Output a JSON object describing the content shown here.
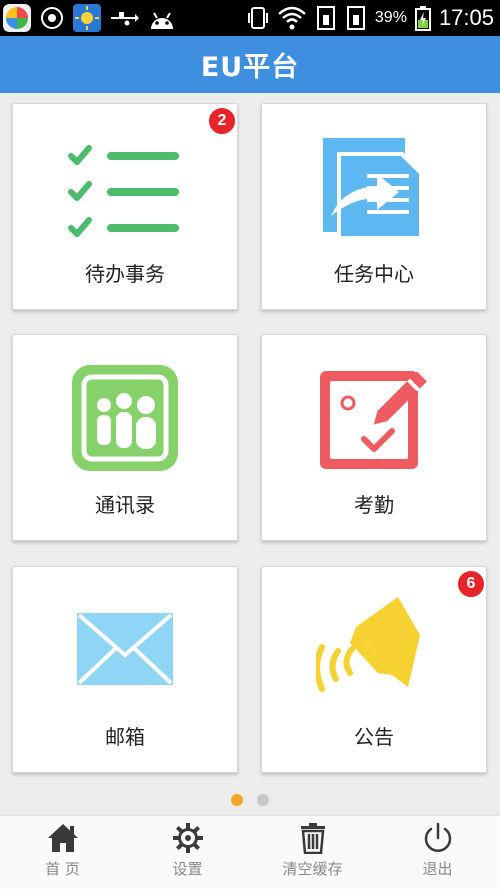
{
  "status_bar": {
    "battery": "39%",
    "time": "17:05"
  },
  "header": {
    "title": "EU平台"
  },
  "tiles": [
    {
      "label": "待办事务",
      "badge": "2",
      "icon": "checklist-icon"
    },
    {
      "label": "任务中心",
      "icon": "task-forward-icon"
    },
    {
      "label": "通讯录",
      "icon": "contacts-icon"
    },
    {
      "label": "考勤",
      "icon": "attendance-edit-icon"
    },
    {
      "label": "邮箱",
      "icon": "mail-envelope-icon"
    },
    {
      "label": "公告",
      "badge": "6",
      "icon": "announcement-speaker-icon"
    }
  ],
  "pager": {
    "active_color": "#f5a623",
    "inactive_color": "#c8c8c8"
  },
  "tabbar": [
    {
      "label": "首 页",
      "icon": "home-icon"
    },
    {
      "label": "设置",
      "icon": "gear-icon"
    },
    {
      "label": "清空缓存",
      "icon": "trash-icon"
    },
    {
      "label": "退出",
      "icon": "power-icon"
    }
  ],
  "colors": {
    "header": "#3e8fe0",
    "badge": "#e8242b",
    "checklist": "#4cbb6c",
    "task": "#5db8f2",
    "contacts": "#86d16a",
    "attendance": "#ee5c61",
    "mail": "#8fd6f6",
    "announcement": "#f5d132"
  }
}
